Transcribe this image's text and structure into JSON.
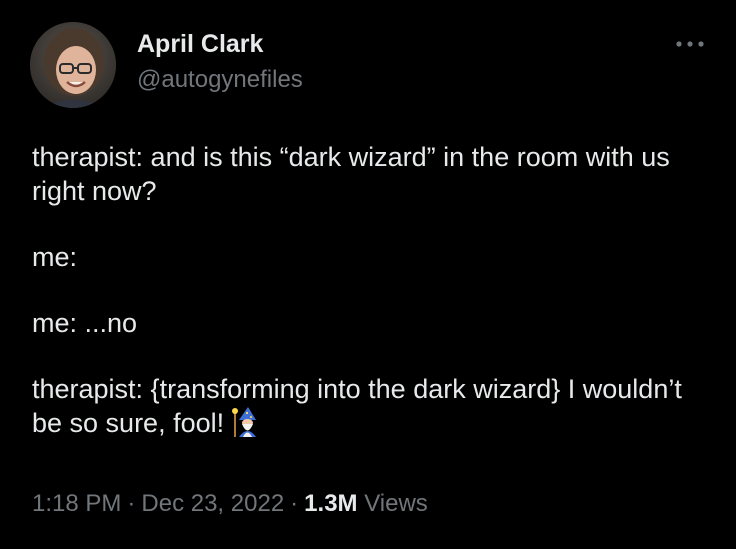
{
  "author": {
    "display_name": "April Clark",
    "handle": "@autogynefiles",
    "avatar_icon": "profile-photo-avatar"
  },
  "menu": {
    "more_icon": "more-horizontal-icon"
  },
  "tweet": {
    "paragraphs": [
      "therapist: and is this “dark wizard” in the room with us right now?",
      "me:",
      "me: ...no",
      "therapist: {transforming into the dark wizard} I wouldn’t be so sure, fool!"
    ],
    "emoji": "wizard-emoji"
  },
  "meta": {
    "time": "1:18 PM",
    "separator": "·",
    "date": "Dec 23, 2022",
    "views_count": "1.3M",
    "views_label": "Views"
  },
  "colors": {
    "background": "#000000",
    "text_primary": "#e7e9ea",
    "text_secondary": "#71767b"
  }
}
